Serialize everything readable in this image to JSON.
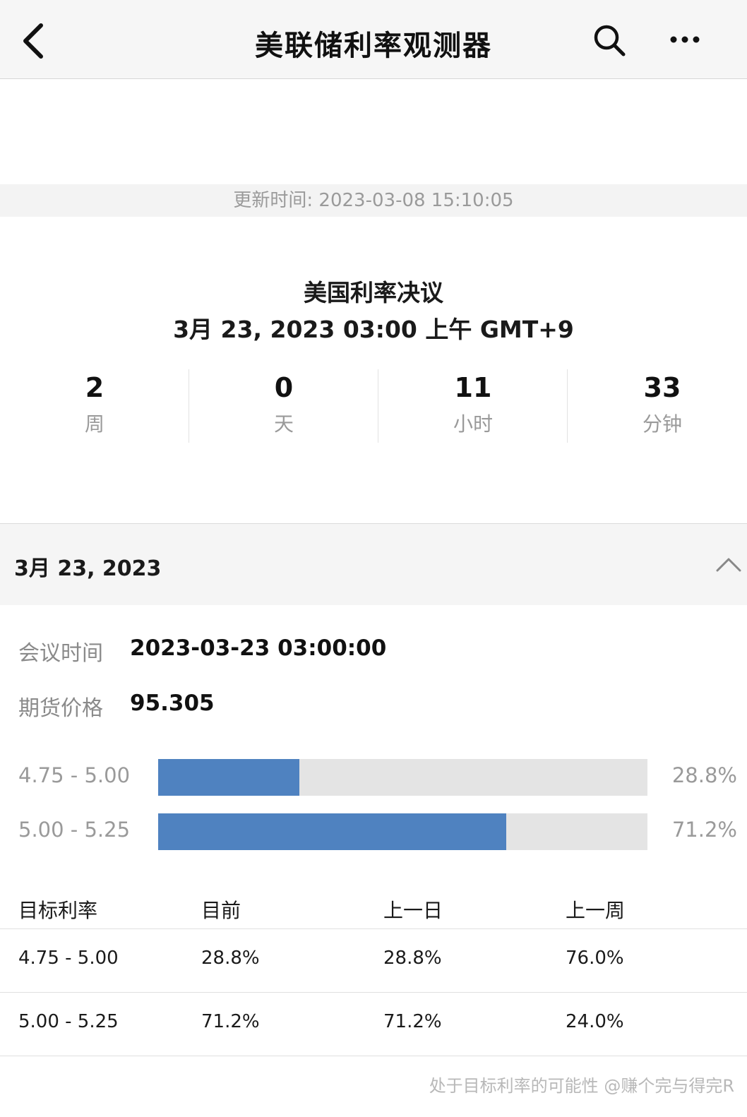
{
  "nav": {
    "title": "美联储利率观测器"
  },
  "update": {
    "text": "更新时间: 2023-03-08 15:10:05"
  },
  "event": {
    "title": "美国利率决议",
    "time": "3月 23, 2023 03:00 上午 GMT+9"
  },
  "countdown": [
    {
      "value": "2",
      "unit": "周"
    },
    {
      "value": "0",
      "unit": "天"
    },
    {
      "value": "11",
      "unit": "小时"
    },
    {
      "value": "33",
      "unit": "分钟"
    }
  ],
  "meeting": {
    "date_header": "3月 23, 2023",
    "time_label": "会议时间",
    "time_value": "2023-03-23 03:00:00",
    "price_label": "期货价格",
    "price_value": "95.305"
  },
  "probabilities": [
    {
      "range": "4.75 - 5.00",
      "percent_text": "28.8%",
      "fraction": 0.288
    },
    {
      "range": "5.00 - 5.25",
      "percent_text": "71.2%",
      "fraction": 0.712
    }
  ],
  "table": {
    "headers": [
      "目标利率",
      "目前",
      "上一日",
      "上一周"
    ],
    "rows": [
      [
        "4.75 - 5.00",
        "28.8%",
        "28.8%",
        "76.0%"
      ],
      [
        "5.00 - 5.25",
        "71.2%",
        "71.2%",
        "24.0%"
      ]
    ]
  },
  "watermark": "处于目标利率的可能性 @赚个完与得完R",
  "colors": {
    "bar_fill": "#4f82c0",
    "bar_track": "#e4e4e4"
  }
}
